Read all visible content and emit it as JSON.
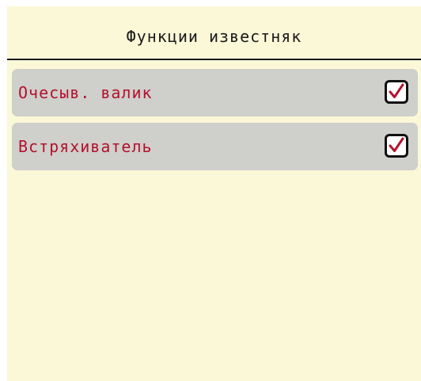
{
  "screen": {
    "title": "Функции известняк"
  },
  "items": [
    {
      "label": "Очесыв. валик",
      "checked": true
    },
    {
      "label": "Встряхиватель",
      "checked": true
    }
  ],
  "colors": {
    "background": "#fbf8d8",
    "row_background": "#cfcfcb",
    "label_text": "#b3122e",
    "check_mark": "#b3122e"
  },
  "icons": {
    "checkbox": "checkbox-checked-icon"
  }
}
